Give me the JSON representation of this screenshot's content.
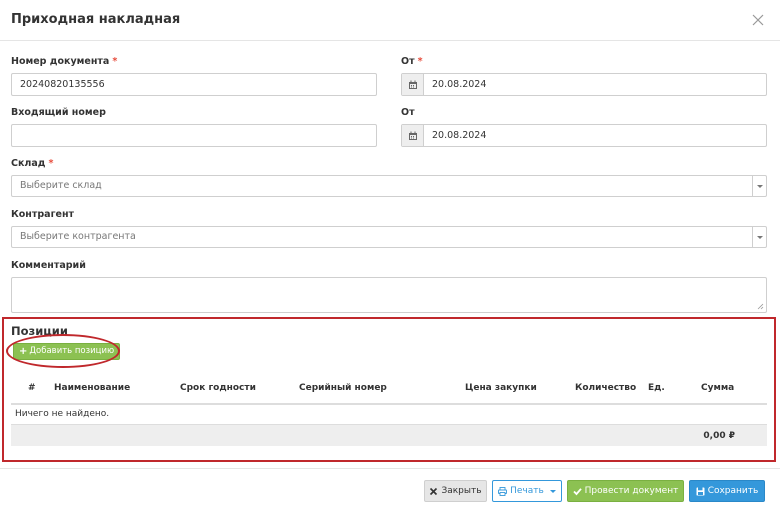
{
  "modal": {
    "title": "Приходная накладная"
  },
  "form": {
    "doc_number_label": "Номер документа",
    "doc_number_value": "20240820135556",
    "date1_label": "От",
    "date1_value": "20.08.2024",
    "incoming_number_label": "Входящий номер",
    "incoming_number_value": "",
    "date2_label": "От",
    "date2_value": "20.08.2024",
    "warehouse_label": "Склад",
    "warehouse_placeholder": "Выберите склад",
    "counterparty_label": "Контрагент",
    "counterparty_placeholder": "Выберите контрагента",
    "comment_label": "Комментарий",
    "required_mark": "*"
  },
  "positions": {
    "title": "Позиции",
    "add_button": "Добавить позицию",
    "columns": [
      "#",
      "Наименование",
      "Срок годности",
      "Серийный номер",
      "Цена закупки",
      "Количество",
      "Ед.",
      "Сумма"
    ],
    "empty_text": "Ничего не найдено.",
    "total": "0,00 ₽"
  },
  "footer": {
    "close_label": "Закрыть",
    "print_label": "Печать",
    "post_label": "Провести документ",
    "save_label": "Сохранить"
  },
  "colors": {
    "accent_blue": "#3498db",
    "accent_green": "#8cc152",
    "highlight_red": "#c0282c",
    "required_red": "#e74c3c"
  }
}
